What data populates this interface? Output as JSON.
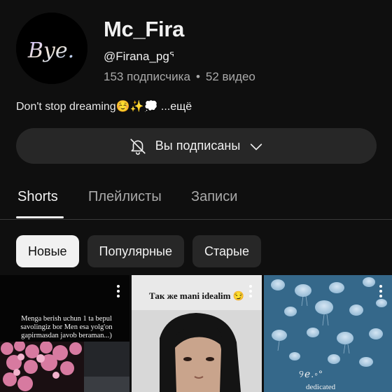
{
  "channel": {
    "avatar_text": "Bye.",
    "name": "Mc_Fira",
    "handle": "@Firana_pgᕐ",
    "subscribers": "153 подписчика",
    "separator": "•",
    "videos": "52 видео",
    "description": "Don't stop  dreaming☺️✨💭",
    "more_label": " ...ещё"
  },
  "subscribe": {
    "bell_icon": "bell-off-icon",
    "label": "Вы подписаны",
    "chevron_icon": "chevron-down-icon"
  },
  "tabs": [
    {
      "label": "Shorts",
      "active": true
    },
    {
      "label": "Плейлисты",
      "active": false
    },
    {
      "label": "Записи",
      "active": false
    }
  ],
  "chips": [
    {
      "label": "Новые",
      "selected": true
    },
    {
      "label": "Популярные",
      "selected": false
    },
    {
      "label": "Старые",
      "selected": false
    }
  ],
  "shorts": [
    {
      "caption": "Menga berish uchun 1 ta bepul savolingiz bor Men esa yolg'on gapirmasdan javob beraman...)",
      "menu_icon": "more-vertical-icon"
    },
    {
      "caption": "Так же mani idealim 😏",
      "menu_icon": "more-vertical-icon"
    },
    {
      "caption_line1": "୨ℯ.◦°",
      "caption_line2": "dedicated",
      "menu_icon": "more-vertical-icon"
    }
  ],
  "colors": {
    "background": "#0f0f0f",
    "surface": "#272727",
    "text_primary": "#f1f1f1",
    "text_secondary": "#aaaaaa"
  }
}
